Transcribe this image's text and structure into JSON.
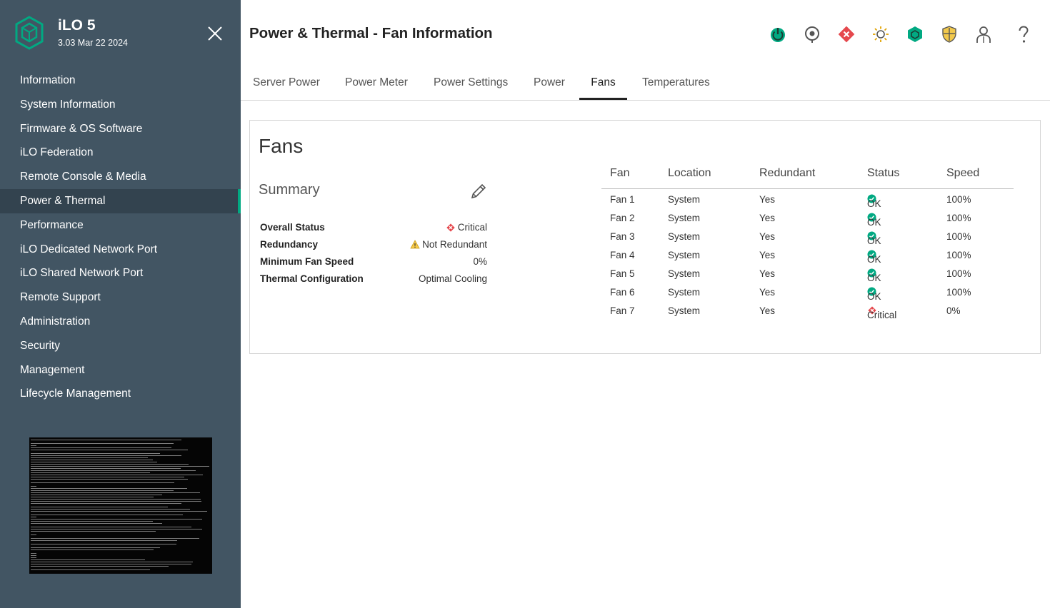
{
  "colors": {
    "sidebar_bg": "#425563",
    "accent": "#01a982",
    "ok": "#01a982",
    "critical": "#e5484d",
    "warning": "#f7c948"
  },
  "brand": {
    "name": "iLO 5",
    "version": "3.03 Mar 22 2024"
  },
  "nav": {
    "items": [
      {
        "label": "Information"
      },
      {
        "label": "System Information"
      },
      {
        "label": "Firmware & OS Software"
      },
      {
        "label": "iLO Federation"
      },
      {
        "label": "Remote Console & Media"
      },
      {
        "label": "Power & Thermal",
        "active": true
      },
      {
        "label": "Performance"
      },
      {
        "label": "iLO Dedicated Network Port"
      },
      {
        "label": "iLO Shared Network Port"
      },
      {
        "label": "Remote Support"
      },
      {
        "label": "Administration"
      },
      {
        "label": "Security"
      },
      {
        "label": "Management"
      },
      {
        "label": "Lifecycle Management"
      }
    ]
  },
  "header": {
    "title": "Power & Thermal - Fan Information",
    "icons": [
      "power-icon",
      "location-icon",
      "health-critical-icon",
      "uid-light-icon",
      "ilo-status-icon",
      "security-shield-icon",
      "user-icon",
      "help-icon"
    ]
  },
  "tabs": [
    {
      "label": "Server Power"
    },
    {
      "label": "Power Meter"
    },
    {
      "label": "Power Settings"
    },
    {
      "label": "Power"
    },
    {
      "label": "Fans",
      "active": true
    },
    {
      "label": "Temperatures"
    }
  ],
  "panel": {
    "title": "Fans",
    "summary": {
      "title": "Summary",
      "rows": [
        {
          "label": "Overall Status",
          "value": "Critical",
          "icon": "critical-icon"
        },
        {
          "label": "Redundancy",
          "value": "Not Redundant",
          "icon": "warning-icon"
        },
        {
          "label": "Minimum Fan Speed",
          "value": "0%"
        },
        {
          "label": "Thermal Configuration",
          "value": "Optimal Cooling"
        }
      ]
    },
    "fan_table": {
      "headers": [
        "Fan",
        "Location",
        "Redundant",
        "Status",
        "Speed"
      ],
      "rows": [
        {
          "fan": "Fan 1",
          "location": "System",
          "redundant": "Yes",
          "status": "OK",
          "status_icon": "ok-icon",
          "speed": "100%"
        },
        {
          "fan": "Fan 2",
          "location": "System",
          "redundant": "Yes",
          "status": "OK",
          "status_icon": "ok-icon",
          "speed": "100%"
        },
        {
          "fan": "Fan 3",
          "location": "System",
          "redundant": "Yes",
          "status": "OK",
          "status_icon": "ok-icon",
          "speed": "100%"
        },
        {
          "fan": "Fan 4",
          "location": "System",
          "redundant": "Yes",
          "status": "OK",
          "status_icon": "ok-icon",
          "speed": "100%"
        },
        {
          "fan": "Fan 5",
          "location": "System",
          "redundant": "Yes",
          "status": "OK",
          "status_icon": "ok-icon",
          "speed": "100%"
        },
        {
          "fan": "Fan 6",
          "location": "System",
          "redundant": "Yes",
          "status": "OK",
          "status_icon": "ok-icon",
          "speed": "100%"
        },
        {
          "fan": "Fan 7",
          "location": "System",
          "redundant": "Yes",
          "status": "Critical",
          "status_icon": "critical-icon",
          "speed": "0%"
        }
      ]
    }
  }
}
